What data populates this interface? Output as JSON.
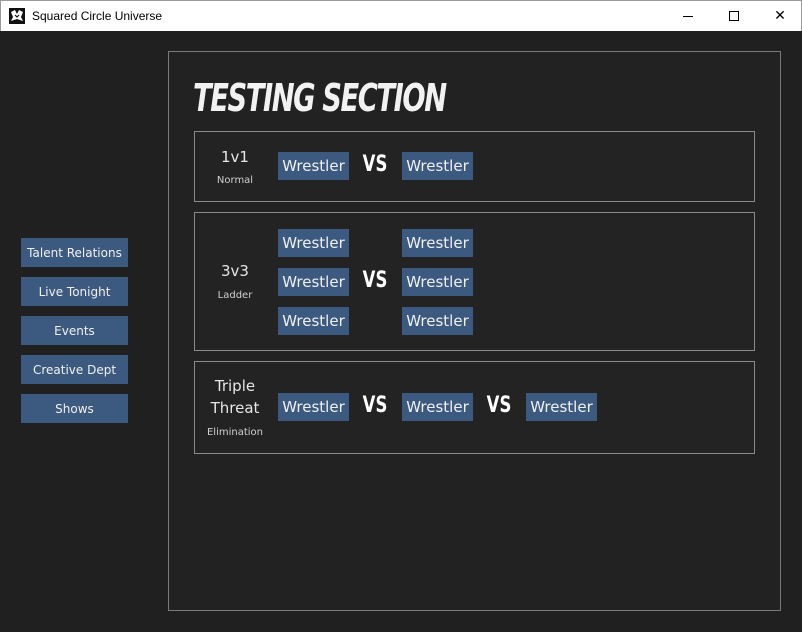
{
  "window": {
    "title": "Squared Circle Universe",
    "icon": "app-logo-icon",
    "controls": {
      "minimize": "minimize-icon",
      "maximize": "maximize-icon",
      "close": "close-icon",
      "close_glyph": "✕"
    }
  },
  "sidebar": {
    "items": [
      {
        "label": "Talent Relations"
      },
      {
        "label": "Live Tonight"
      },
      {
        "label": "Events"
      },
      {
        "label": "Creative Dept"
      },
      {
        "label": "Shows"
      }
    ]
  },
  "main": {
    "title": "TESTING SECTION",
    "matches": [
      {
        "type": "1v1",
        "stipulation": "Normal",
        "vs": "VS",
        "wrestlers": [
          "Wrestler",
          "Wrestler"
        ]
      },
      {
        "type": "3v3",
        "stipulation": "Ladder",
        "vs": "VS",
        "wrestlers": [
          "Wrestler",
          "Wrestler",
          "Wrestler",
          "Wrestler",
          "Wrestler",
          "Wrestler"
        ]
      },
      {
        "type_line1": "Triple",
        "type_line2": "Threat",
        "stipulation": "Elimination",
        "vs": [
          "VS",
          "VS"
        ],
        "wrestlers": [
          "Wrestler",
          "Wrestler",
          "Wrestler"
        ]
      }
    ]
  },
  "colors": {
    "background": "#202020",
    "button": "#3c5a80",
    "border": "#8a8a8a",
    "text": "#f0f0f0"
  }
}
